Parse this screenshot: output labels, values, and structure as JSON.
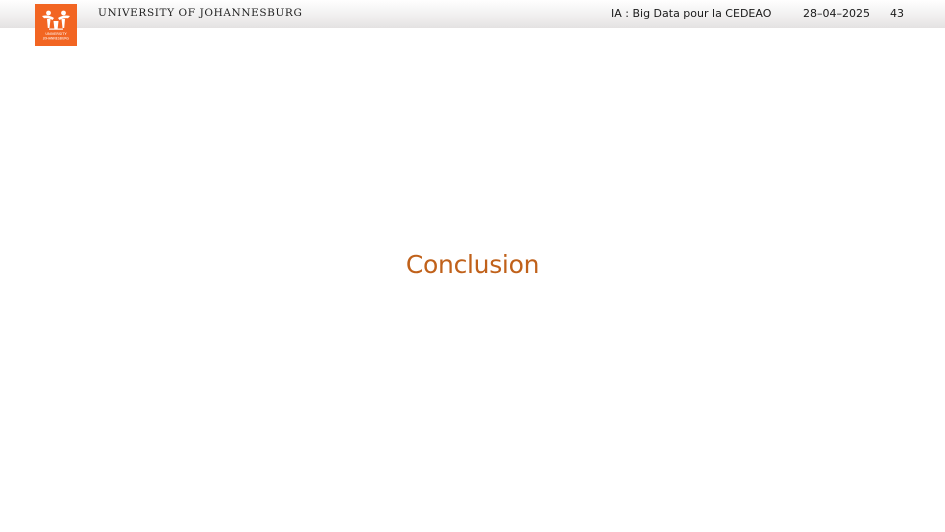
{
  "header": {
    "institution": "UNIVERSITY OF JOHANNESBURG",
    "presentation_title": "IA : Big Data pour la CEDEAO",
    "date": "28–04–2025",
    "page_number": "43",
    "logo": {
      "icon": "university-of-johannesburg-logo-icon",
      "text_line1": "UNIVERSITY",
      "text_line2": "JOHANNESBURG",
      "color": "#f26522"
    }
  },
  "main": {
    "section_title": "Conclusion",
    "title_color": "#c0611a"
  }
}
